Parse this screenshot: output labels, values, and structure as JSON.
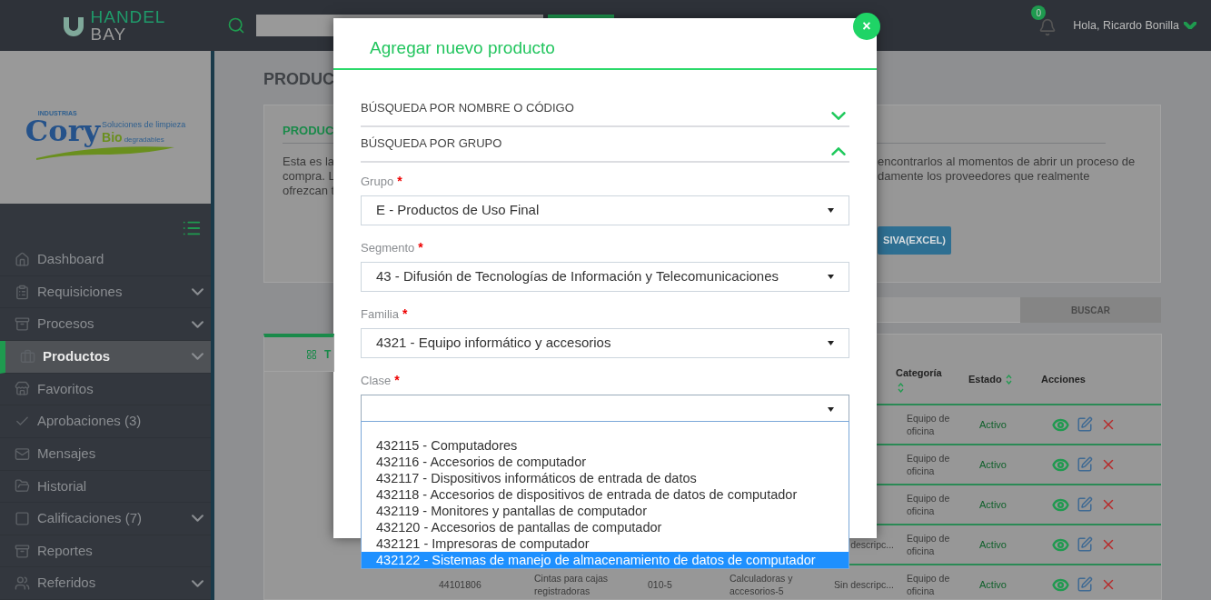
{
  "header": {
    "logo": [
      "HANDEL",
      "BAY"
    ],
    "notifications": "0",
    "greeting": "Hola, Ricardo Bonilla"
  },
  "company_logo": {
    "top": "INDUSTRIAS",
    "name": "Cory",
    "tagline": "Soluciones de limpieza",
    "bio": "Bio",
    "tail": "degradables"
  },
  "sidebar": {
    "items": [
      {
        "label": "Dashboard",
        "expandable": false,
        "selected": false
      },
      {
        "label": "Requisiciones",
        "expandable": true,
        "selected": false
      },
      {
        "label": "Procesos",
        "expandable": true,
        "selected": false
      },
      {
        "label": "Productos",
        "expandable": true,
        "selected": true
      },
      {
        "label": "Favoritos",
        "expandable": false,
        "selected": false
      },
      {
        "label": "Aprobaciones (3)",
        "expandable": false,
        "selected": false
      },
      {
        "label": "Mensajes",
        "expandable": false,
        "selected": false
      },
      {
        "label": "Historial",
        "expandable": false,
        "selected": false
      },
      {
        "label": "Calificaciones (7)",
        "expandable": true,
        "selected": false
      },
      {
        "label": "Reportes",
        "expandable": false,
        "selected": false
      },
      {
        "label": "Referidos",
        "expandable": true,
        "selected": false
      }
    ]
  },
  "page": {
    "title": "PRODUC",
    "card_title": "PRODUC",
    "text_left": [
      "Esta es la",
      "compra. L",
      "ofrezcan t"
    ],
    "text_right": [
      "encontrarlos al momentos de abrir un proceso de",
      "damente los proveedores que realmente"
    ],
    "excel_button": "SIVA(EXCEL)",
    "search_button": "BUSCAR",
    "tab": "T"
  },
  "table": {
    "columns": [
      "Categoría",
      "Estado",
      "Acciones"
    ],
    "rows": [
      {
        "category": "Equipo de oficina",
        "status": "Activo"
      },
      {
        "category": "Equipo de oficina",
        "status": "Activo"
      },
      {
        "category": "Equipo de oficina",
        "status": "Activo"
      },
      {
        "description": "descripc...",
        "category": "Equipo de oficina",
        "status": "Activo"
      },
      {
        "code": "44101806",
        "name": "Cintas para cajas registradoras",
        "reference": "010-5",
        "subcategory": "Calculadoras y accesorios-5",
        "description": "Sin descripc...",
        "category": "Equipo de oficina",
        "status": "Activo"
      }
    ]
  },
  "modal": {
    "title": "Agregar nuevo producto",
    "close": "×",
    "sections": [
      {
        "label": "BÚSQUEDA POR NOMBRE O CÓDIGO",
        "expanded": false
      },
      {
        "label": "BÚSQUEDA POR GRUPO",
        "expanded": true
      }
    ],
    "fields": [
      {
        "label": "Grupo",
        "required_mark": "*",
        "value": "E - Productos de Uso Final",
        "open": false
      },
      {
        "label": "Segmento",
        "required_mark": "*",
        "value": "43 - Difusión de Tecnologías de Información y Telecomunicaciones",
        "open": false
      },
      {
        "label": "Familia",
        "required_mark": "*",
        "value": "4321 - Equipo informático y accesorios",
        "open": false
      },
      {
        "label": "Clase",
        "required_mark": "*",
        "open": true
      }
    ],
    "options": [
      {
        "label": "432115 - Computadores",
        "selected": false
      },
      {
        "label": "432116 - Accesorios de computador",
        "selected": false
      },
      {
        "label": "432117 - Dispositivos informáticos de entrada de datos",
        "selected": false
      },
      {
        "label": "432118 - Accesorios de dispositivos de entrada de datos de computador",
        "selected": false
      },
      {
        "label": "432119 - Monitores y pantallas de computador",
        "selected": false
      },
      {
        "label": "432120 - Accesorios de pantallas de computador",
        "selected": false
      },
      {
        "label": "432121 - Impresoras de computador",
        "selected": false
      },
      {
        "label": "432122 - Sistemas de manejo de almacenamiento de datos de computador",
        "selected": true
      }
    ]
  }
}
